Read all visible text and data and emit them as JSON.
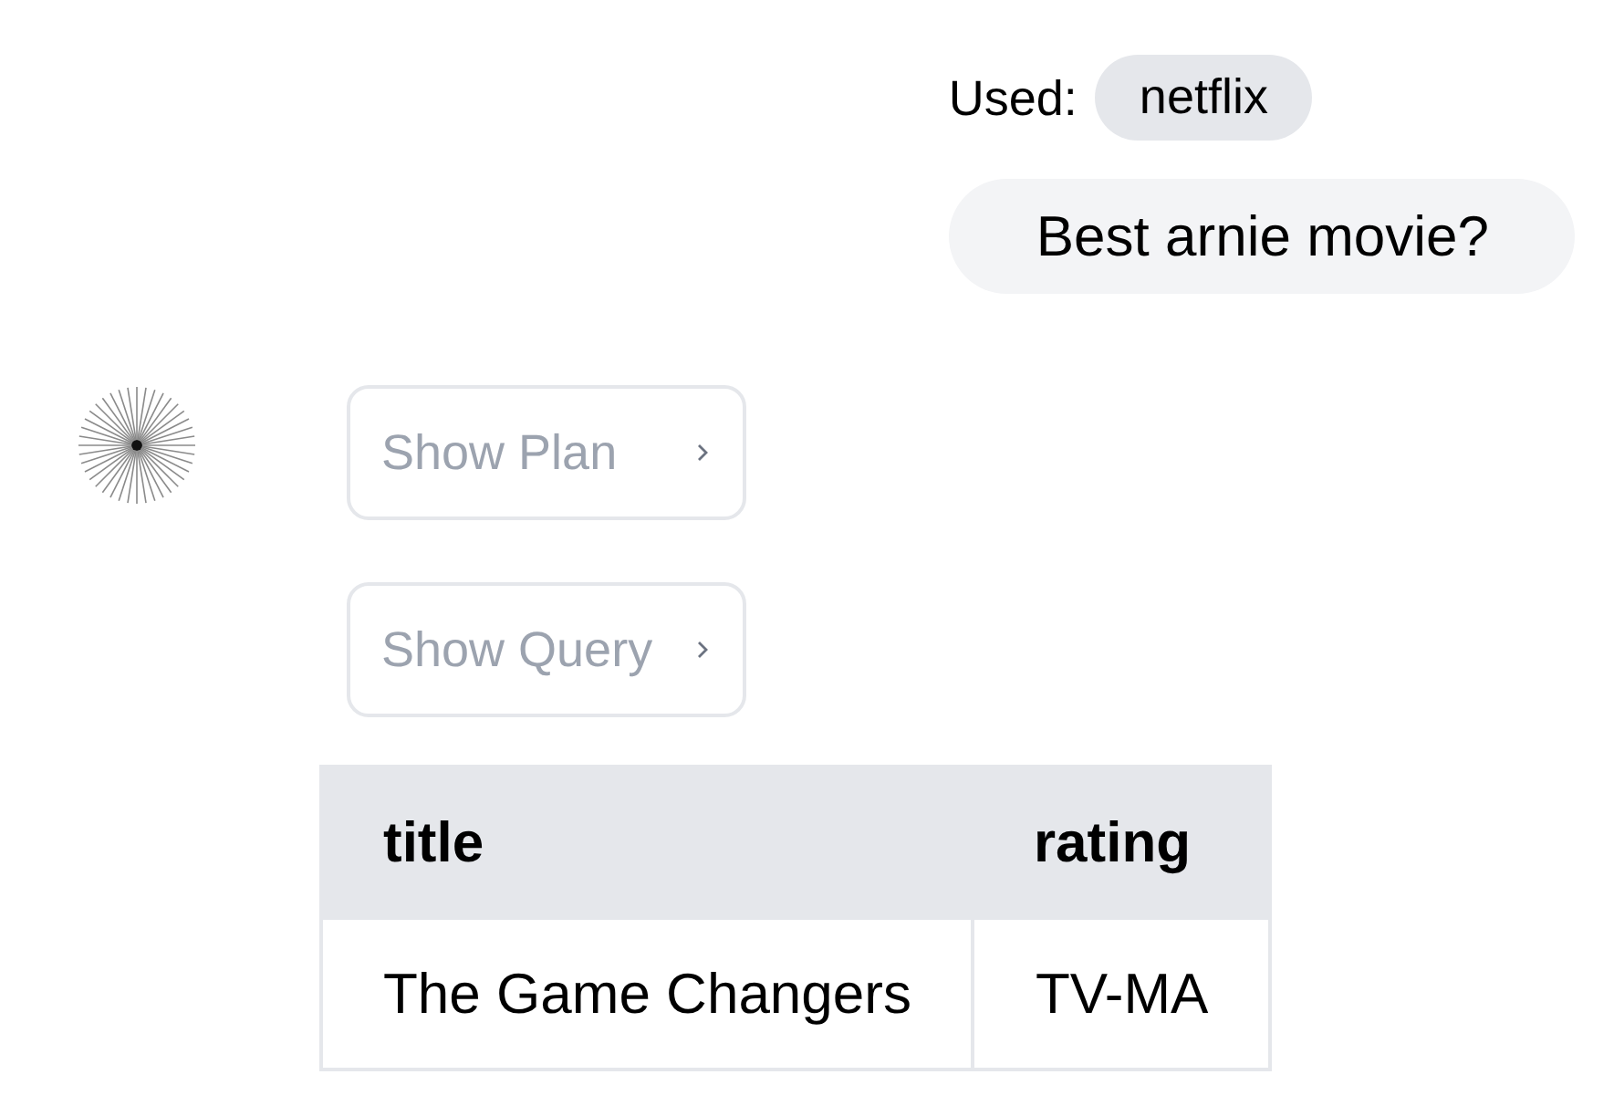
{
  "query_context": {
    "label": "Used:",
    "sources": [
      {
        "name": "netflix"
      }
    ]
  },
  "user_message": {
    "text": "Best arnie movie?"
  },
  "assistant": {
    "toggles": [
      {
        "label": "Show Plan",
        "expanded": false
      },
      {
        "label": "Show Query",
        "expanded": false
      }
    ],
    "table": {
      "columns": [
        "title",
        "rating"
      ],
      "rows": [
        [
          "The Game Changers",
          "TV-MA"
        ]
      ]
    }
  }
}
